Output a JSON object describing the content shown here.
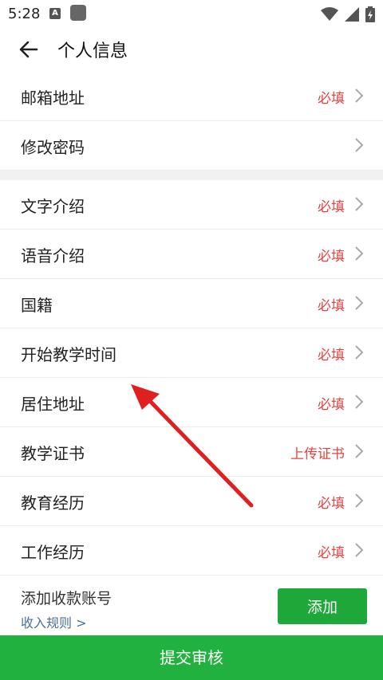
{
  "status": {
    "time": "5:28",
    "a_icon": "A"
  },
  "header": {
    "title": "个人信息"
  },
  "sections": [
    {
      "rows": [
        {
          "label": "邮箱地址",
          "value": "必填"
        },
        {
          "label": "修改密码",
          "value": ""
        }
      ]
    },
    {
      "rows": [
        {
          "label": "文字介绍",
          "value": "必填"
        },
        {
          "label": "语音介绍",
          "value": "必填"
        },
        {
          "label": "国籍",
          "value": "必填"
        },
        {
          "label": "开始教学时间",
          "value": "必填"
        },
        {
          "label": "居住地址",
          "value": "必填"
        },
        {
          "label": "教学证书",
          "value": "上传证书"
        },
        {
          "label": "教育经历",
          "value": "必填"
        },
        {
          "label": "工作经历",
          "value": "必填"
        }
      ]
    }
  ],
  "payout": {
    "title": "添加收款账号",
    "link": "收入规则 >",
    "button": "添加"
  },
  "submit": {
    "label": "提交审核"
  },
  "colors": {
    "accent_green": "#20b13f",
    "required_red": "#e64340",
    "annotation_arrow": "#e02020"
  }
}
